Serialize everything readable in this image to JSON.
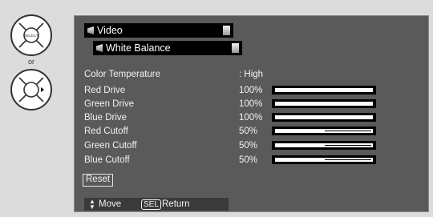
{
  "remote": {
    "select_label": "SELECT",
    "or_label": "or"
  },
  "menu": {
    "video_label": "Video",
    "white_balance_label": "White Balance"
  },
  "settings": {
    "color_temperature": {
      "label": "Color Temperature",
      "value": ": High"
    },
    "red_drive": {
      "label": "Red Drive",
      "value": "100%",
      "level": 1.0
    },
    "green_drive": {
      "label": "Green Drive",
      "value": "100%",
      "level": 1.0
    },
    "blue_drive": {
      "label": "Blue Drive",
      "value": "100%",
      "level": 1.0
    },
    "red_cutoff": {
      "label": "Red Cutoff",
      "value": "50%",
      "level": 0.5
    },
    "green_cutoff": {
      "label": "Green Cutoff",
      "value": "50%",
      "level": 0.5
    },
    "blue_cutoff": {
      "label": "Blue Cutoff",
      "value": "50%",
      "level": 0.5
    }
  },
  "reset_label": "Reset",
  "footer": {
    "move_label": "Move",
    "sel_key": "SEL",
    "return_label": "Return"
  },
  "icons": {
    "arrows": "up-down-arrows-icon"
  },
  "colors": {
    "panel_bg": "#5a5a5a",
    "bar_bg": "#000000",
    "text": "#f2f2f2",
    "page_bg": "#dcdcdc"
  }
}
